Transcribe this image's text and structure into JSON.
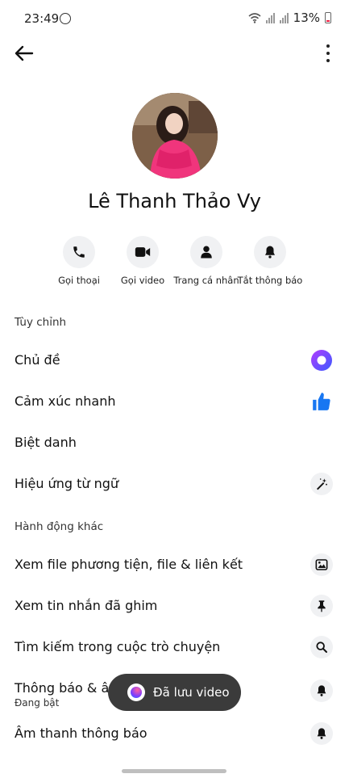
{
  "status_bar": {
    "time": "23:49",
    "battery": "13%"
  },
  "contact": {
    "name": "Lê Thanh Thảo Vy"
  },
  "actions": [
    {
      "label": "Gọi thoại",
      "icon": "phone-icon"
    },
    {
      "label": "Gọi video",
      "icon": "video-icon"
    },
    {
      "label": "Trang cá nhân",
      "icon": "person-icon"
    },
    {
      "label": "Tắt thông báo",
      "icon": "bell-icon"
    }
  ],
  "customize": {
    "title": "Tùy chỉnh",
    "items": [
      {
        "label": "Chủ đề",
        "icon": "theme-icon"
      },
      {
        "label": "Cảm xúc nhanh",
        "icon": "thumbs-up-icon"
      },
      {
        "label": "Biệt danh",
        "icon": ""
      },
      {
        "label": "Hiệu ứng từ ngữ",
        "icon": "magic-wand-icon"
      }
    ]
  },
  "other_actions": {
    "title": "Hành động khác",
    "items": [
      {
        "label": "Xem file phương tiện, file & liên kết",
        "icon": "image-icon"
      },
      {
        "label": "Xem tin nhắn đã ghim",
        "icon": "pin-icon"
      },
      {
        "label": "Tìm kiếm trong cuộc trò chuyện",
        "icon": "search-icon"
      },
      {
        "label": "Thông báo & âm thanh",
        "sublabel": "Đang bật",
        "icon": "bell-icon"
      },
      {
        "label": "Âm thanh thông báo",
        "icon": "bell-icon"
      }
    ]
  },
  "toast": {
    "text": "Đã lưu video"
  },
  "colors": {
    "accent": "#1877f2",
    "theme_ring": "#6a3df5"
  }
}
